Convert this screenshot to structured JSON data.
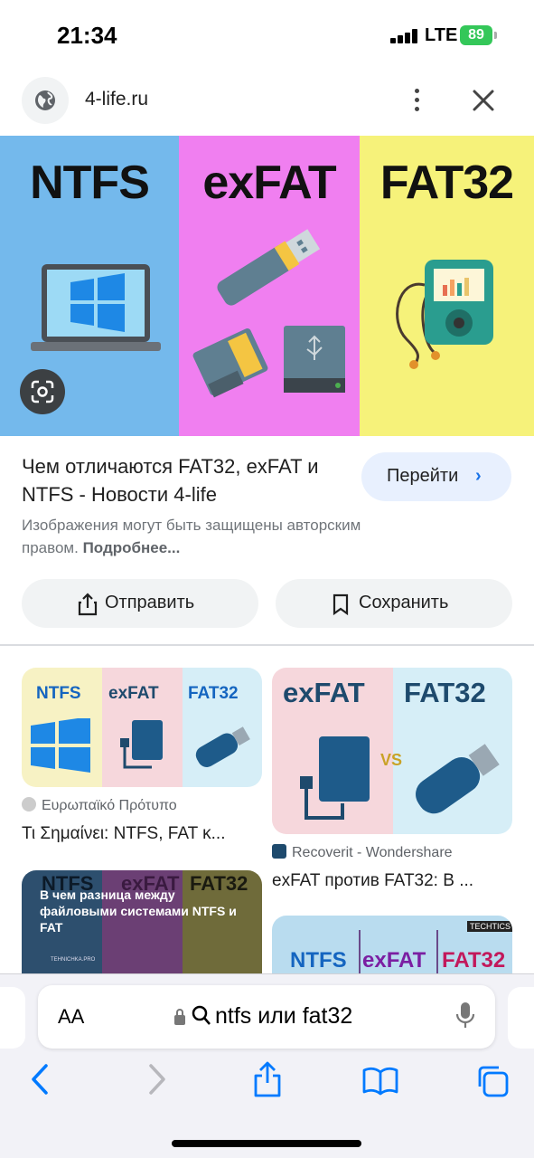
{
  "status": {
    "time": "21:34",
    "network": "LTE",
    "battery": "89"
  },
  "header": {
    "site": "4-life.ru"
  },
  "hero": {
    "labels": [
      "NTFS",
      "exFAT",
      "FAT32"
    ]
  },
  "result": {
    "title": "Чем отличаются FAT32, exFAT и NTFS - Новости 4-life",
    "goto_label": "Перейти",
    "copyright_text": "Изображения могут быть защищены авторским правом.",
    "more_link": "Подробнее...",
    "share_label": "Отправить",
    "save_label": "Сохранить"
  },
  "grid": {
    "cards": [
      {
        "source": "Ευρωπαϊκό Πρότυπο",
        "title": "Τι Σημαίνει: NTFS, FAT κ...",
        "labels": [
          "NTFS",
          "exFAT",
          "FAT32"
        ]
      },
      {
        "source": "Recoverit - Wondershare",
        "title": "exFAT против FAT32: В ...",
        "labels": [
          "exFAT",
          "FAT32",
          "VS"
        ]
      },
      {
        "caption": "В чем разница между файловыми системами NTFS и FAT",
        "labels": [
          "NTFS",
          "exFAT",
          "FAT32"
        ],
        "watermark": "TEHNICHKA.PRO"
      },
      {
        "labels": [
          "NTFS",
          "exFAT",
          "FAT32"
        ],
        "badge": "TECHTICS"
      }
    ]
  },
  "browser": {
    "aa_label": "AA",
    "url_text": "ntfs или fat32"
  },
  "colors": {
    "ntfs_blue": "#74b9ec",
    "exfat_pink": "#f07ff0",
    "fat32_yellow": "#f6f27a",
    "accent": "#1a73e8",
    "ios_blue": "#007aff"
  }
}
